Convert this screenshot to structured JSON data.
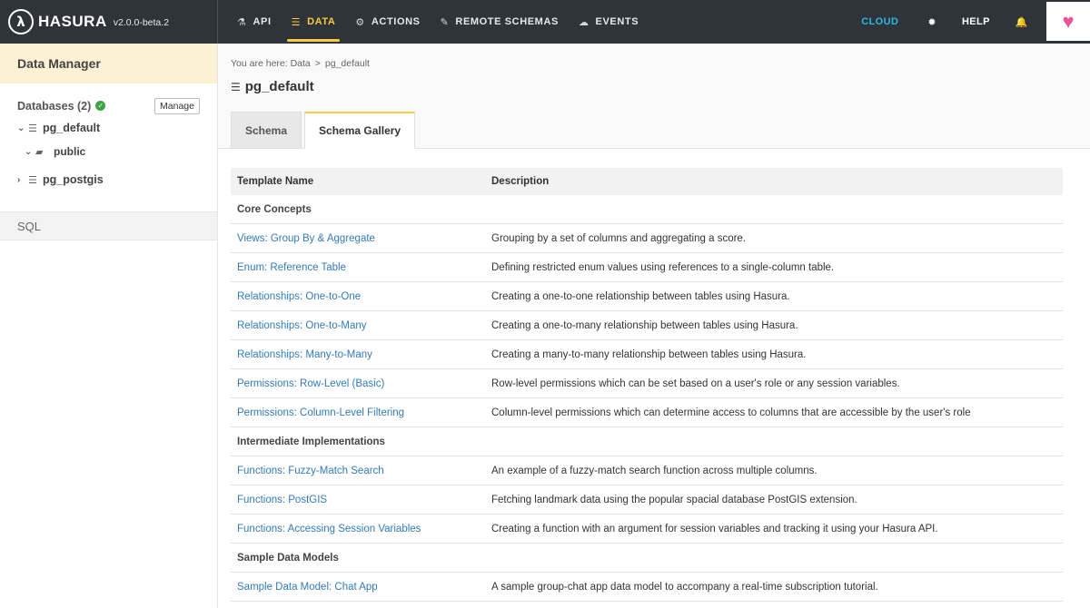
{
  "brand": {
    "logo_glyph": "λ",
    "name": "HASURA",
    "version": "v2.0.0-beta.2"
  },
  "nav": {
    "items": [
      {
        "icon": "flask-icon",
        "glyph": "⚗",
        "label": "API"
      },
      {
        "icon": "database-icon",
        "glyph": "☰",
        "label": "DATA"
      },
      {
        "icon": "cogs-icon",
        "glyph": "⚙",
        "label": "ACTIONS"
      },
      {
        "icon": "plug-icon",
        "glyph": "✎",
        "label": "REMOTE SCHEMAS"
      },
      {
        "icon": "cloud-icon",
        "glyph": "☁",
        "label": "EVENTS"
      }
    ],
    "active": "DATA",
    "right": {
      "cloud": "CLOUD",
      "settings_glyph": "✹",
      "help": "HELP",
      "bell_glyph": "🔔",
      "heart_glyph": "♥"
    }
  },
  "colors": {
    "nav_bg": "#2e3439",
    "accent": "#f8ca3f",
    "cloud": "#2cb7df",
    "link": "#337ab7",
    "heart": "#e85595",
    "ok": "#3ea43e"
  },
  "sidebar": {
    "header": "Data Manager",
    "databases_label": "Databases (2)",
    "manage_label": "Manage",
    "tree": {
      "pg_default": {
        "chev": "⌄",
        "label": "pg_default"
      },
      "public": {
        "chev": "⌄",
        "label": "public"
      },
      "pg_postgis": {
        "chev": "›",
        "label": "pg_postgis"
      }
    },
    "sql_label": "SQL"
  },
  "main": {
    "breadcrumb": {
      "prefix": "You are here: Data",
      "sep": ">",
      "current": "pg_default"
    },
    "title": "pg_default",
    "tabs": [
      {
        "label": "Schema"
      },
      {
        "label": "Schema Gallery"
      }
    ],
    "active_tab": "Schema Gallery",
    "table": {
      "headers": {
        "name": "Template Name",
        "description": "Description"
      },
      "groups": [
        {
          "title": "Core Concepts",
          "rows": [
            {
              "name": "Views: Group By & Aggregate",
              "description": "Grouping by a set of columns and aggregating a score."
            },
            {
              "name": "Enum: Reference Table",
              "description": "Defining restricted enum values using references to a single-column table."
            },
            {
              "name": "Relationships: One-to-One",
              "description": "Creating a one-to-one relationship between tables using Hasura."
            },
            {
              "name": "Relationships: One-to-Many",
              "description": "Creating a one-to-many relationship between tables using Hasura."
            },
            {
              "name": "Relationships: Many-to-Many",
              "description": "Creating a many-to-many relationship between tables using Hasura."
            },
            {
              "name": "Permissions: Row-Level (Basic)",
              "description": "Row-level permissions which can be set based on a user's role or any session variables."
            },
            {
              "name": "Permissions: Column-Level Filtering",
              "description": "Column-level permissions which can determine access to columns that are accessible by the user's role"
            }
          ]
        },
        {
          "title": "Intermediate Implementations",
          "rows": [
            {
              "name": "Functions: Fuzzy-Match Search",
              "description": "An example of a fuzzy-match search function across multiple columns."
            },
            {
              "name": "Functions: PostGIS",
              "description": "Fetching landmark data using the popular spacial database PostGIS extension."
            },
            {
              "name": "Functions: Accessing Session Variables",
              "description": "Creating a function with an argument for session variables and tracking it using your Hasura API."
            }
          ]
        },
        {
          "title": "Sample Data Models",
          "rows": [
            {
              "name": "Sample Data Model: Chat App",
              "description": "A sample group-chat app data model to accompany a real-time subscription tutorial."
            }
          ]
        }
      ]
    }
  }
}
